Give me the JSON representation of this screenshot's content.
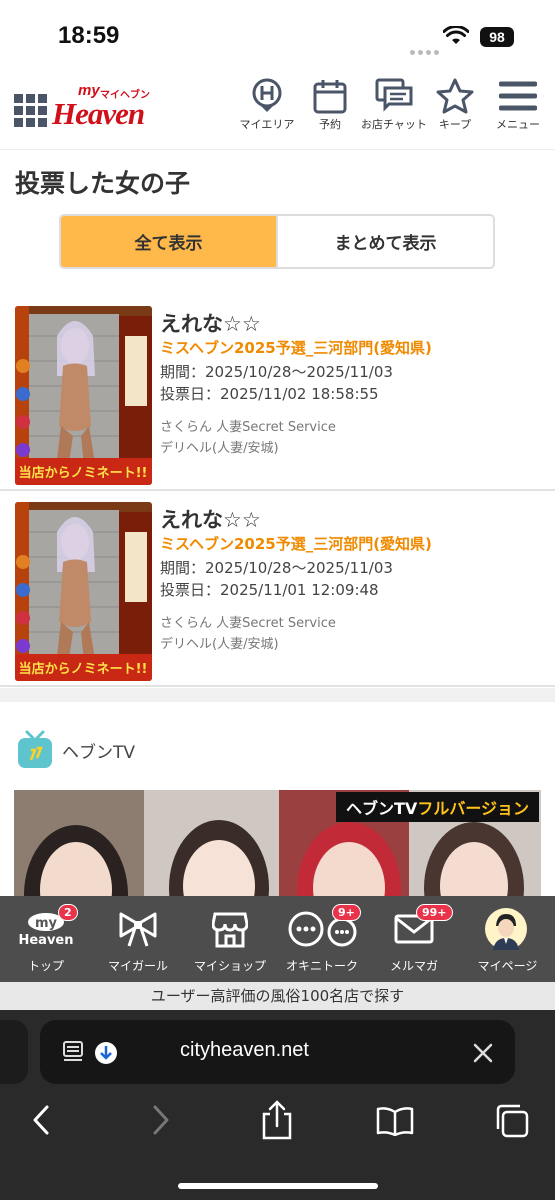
{
  "status_bar": {
    "time": "18:59",
    "battery": "98"
  },
  "header": {
    "logo": {
      "my": "my",
      "kana": "マイヘブン",
      "heaven": "Heaven"
    },
    "nav": [
      {
        "label": "マイエリア",
        "icon": "area-pin-icon"
      },
      {
        "label": "予約",
        "icon": "calendar-icon"
      },
      {
        "label": "お店チャット",
        "icon": "chat-icon"
      },
      {
        "label": "キープ",
        "icon": "star-icon"
      },
      {
        "label": "メニュー",
        "icon": "hamburger-menu-icon"
      }
    ]
  },
  "page_title": "投票した女の子",
  "tabs": {
    "all": "全て表示",
    "grouped": "まとめて表示",
    "active": "all"
  },
  "votes": [
    {
      "name": "えれな☆☆",
      "contest": "ミスヘブン2025予選_三河部門(愛知県)",
      "period": "期間：2025/10/28〜2025/11/03",
      "vote_date": "投票日：2025/11/02 18:58:55",
      "shop": "さくらん 人妻Secret Service",
      "genre": "デリヘル(人妻/安城)",
      "photo_caption": "当店からノミネート!!"
    },
    {
      "name": "えれな☆☆",
      "contest": "ミスヘブン2025予選_三河部門(愛知県)",
      "period": "期間：2025/10/28〜2025/11/03",
      "vote_date": "投票日：2025/11/01 12:09:48",
      "shop": "さくらん 人妻Secret Service",
      "genre": "デリヘル(人妻/安城)",
      "photo_caption": "当店からノミネート!!"
    }
  ],
  "heaven_tv": {
    "title": "ヘブンTV",
    "banner_label_white": "ヘブンTV",
    "banner_label_yellow": "フルバージョン"
  },
  "bottom_nav": [
    {
      "label": "トップ",
      "icon": "my-heaven-logo-icon",
      "badge": "2"
    },
    {
      "label": "マイガール",
      "icon": "ribbon-icon"
    },
    {
      "label": "マイショップ",
      "icon": "shop-icon"
    },
    {
      "label": "オキニトーク",
      "icon": "talk-bubbles-icon",
      "badge": "9+"
    },
    {
      "label": "メルマガ",
      "icon": "mail-icon",
      "badge": "99+"
    },
    {
      "label": "マイページ",
      "icon": "avatar-icon"
    }
  ],
  "bottom_nav_logo": {
    "my": "my",
    "heaven": "Heaven"
  },
  "promo_strip": "ユーザー高評価の風俗100名店で探す",
  "browser": {
    "url": "cityheaven.net"
  },
  "colors": {
    "accent": "#ffb94a",
    "brand_red": "#d0101a",
    "contest_orange": "#f08a00",
    "nav_bg": "#4d4d4d",
    "badge_red": "#e8334a"
  }
}
